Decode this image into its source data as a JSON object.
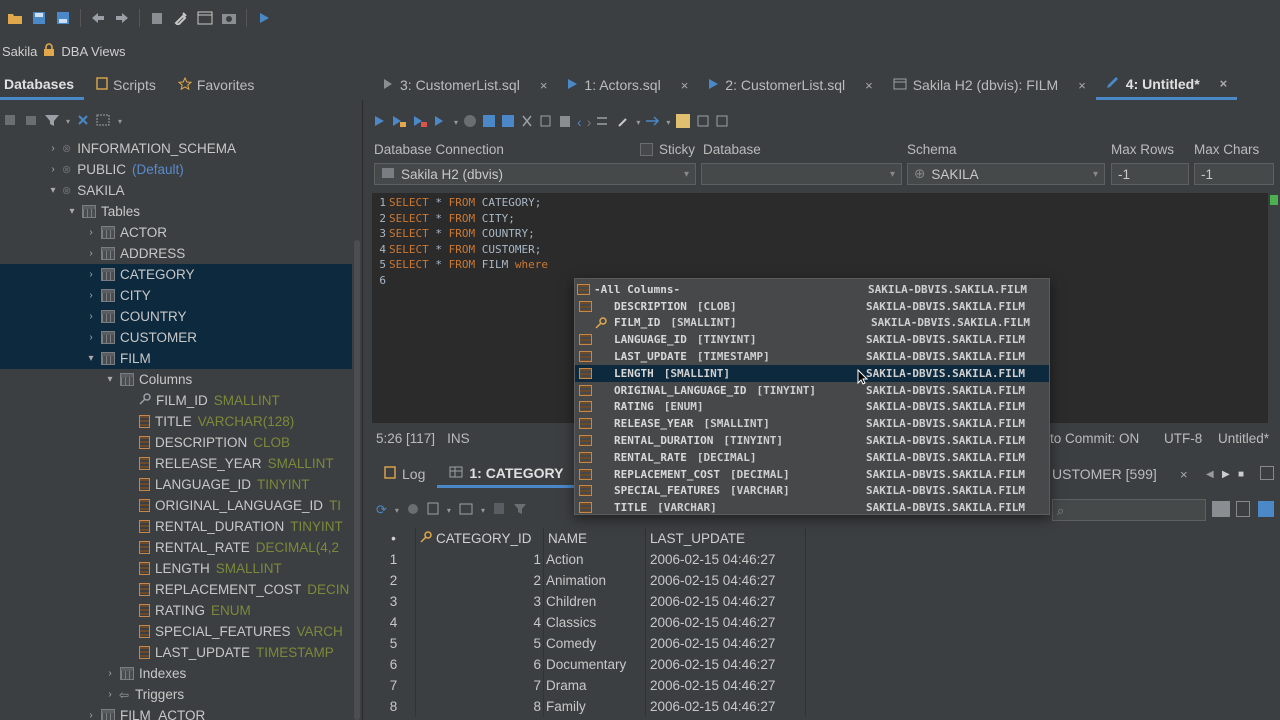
{
  "toolbar": {
    "icons": [
      "open-folder-icon",
      "save-icon",
      "save-all-icon",
      "back-icon",
      "forward-icon",
      "clipboard-icon",
      "tools-icon",
      "window-icon",
      "settings-icon",
      "run-icon"
    ]
  },
  "context": {
    "connection": "Sakila",
    "view": "DBA Views"
  },
  "left_tabs": [
    {
      "label": "Databases",
      "active": true
    },
    {
      "label": "Scripts",
      "active": false
    },
    {
      "label": "Favorites",
      "active": false
    }
  ],
  "tree": {
    "information_schema": "INFORMATION_SCHEMA",
    "public": "PUBLIC",
    "public_tag": "(Default)",
    "sakila": "SAKILA",
    "tables": "Tables",
    "table_items": [
      "ACTOR",
      "ADDRESS",
      "CATEGORY",
      "CITY",
      "COUNTRY",
      "CUSTOMER",
      "FILM"
    ],
    "columns": "Columns",
    "column_items": [
      {
        "name": "FILM_ID",
        "type": "SMALLINT"
      },
      {
        "name": "TITLE",
        "type": "VARCHAR(128)"
      },
      {
        "name": "DESCRIPTION",
        "type": "CLOB"
      },
      {
        "name": "RELEASE_YEAR",
        "type": "SMALLINT"
      },
      {
        "name": "LANGUAGE_ID",
        "type": "TINYINT"
      },
      {
        "name": "ORIGINAL_LANGUAGE_ID",
        "type": "TI"
      },
      {
        "name": "RENTAL_DURATION",
        "type": "TINYINT"
      },
      {
        "name": "RENTAL_RATE",
        "type": "DECIMAL(4,2"
      },
      {
        "name": "LENGTH",
        "type": "SMALLINT"
      },
      {
        "name": "REPLACEMENT_COST",
        "type": "DECIN"
      },
      {
        "name": "RATING",
        "type": "ENUM"
      },
      {
        "name": "SPECIAL_FEATURES",
        "type": "VARCH"
      },
      {
        "name": "LAST_UPDATE",
        "type": "TIMESTAMP"
      }
    ],
    "indexes": "Indexes",
    "triggers": "Triggers",
    "film_actor": "FILM_ACTOR"
  },
  "editor_tabs": [
    {
      "label": "3: CustomerList.sql",
      "active": false
    },
    {
      "label": "1: Actors.sql",
      "active": false
    },
    {
      "label": "2: CustomerList.sql",
      "active": false
    },
    {
      "label": "Sakila H2 (dbvis): FILM",
      "active": false
    },
    {
      "label": "4: Untitled*",
      "active": true
    }
  ],
  "close_glyph": "×",
  "connection_row": {
    "db_connection_label": "Database Connection",
    "sticky_label": "Sticky",
    "database_label": "Database",
    "schema_label": "Schema",
    "max_rows_label": "Max Rows",
    "max_chars_label": "Max Chars",
    "db_connection_value": "Sakila H2 (dbvis)",
    "database_value": "",
    "schema_value": "SAKILA",
    "max_rows_value": "-1",
    "max_chars_value": "-1"
  },
  "code": [
    {
      "n": "1",
      "kw1": "SELECT",
      "star": " * ",
      "kw2": "FROM",
      "rest": " CATEGORY;",
      "kw3": ""
    },
    {
      "n": "2",
      "kw1": "SELECT",
      "star": " * ",
      "kw2": "FROM",
      "rest": " CITY;",
      "kw3": ""
    },
    {
      "n": "3",
      "kw1": "SELECT",
      "star": " * ",
      "kw2": "FROM",
      "rest": " COUNTRY;",
      "kw3": ""
    },
    {
      "n": "4",
      "kw1": "SELECT",
      "star": " * ",
      "kw2": "FROM",
      "rest": " CUSTOMER;",
      "kw3": ""
    },
    {
      "n": "5",
      "kw1": "SELECT",
      "star": " * ",
      "kw2": "FROM",
      "rest": " FILM ",
      "kw3": "where"
    },
    {
      "n": "6",
      "kw1": "",
      "star": "",
      "kw2": "",
      "rest": "",
      "kw3": ""
    }
  ],
  "editor_status": {
    "position": "5:26 [117]",
    "mode": "INS",
    "autocommit": "to Commit: ON",
    "encoding": "UTF-8",
    "file": "Untitled*"
  },
  "result_tabs": [
    {
      "label": "Log",
      "active": false
    },
    {
      "label": "1: CATEGORY",
      "active": true
    }
  ],
  "result_right_tab": "USTOMER [599]",
  "grid": {
    "headers": [
      "CATEGORY_ID",
      "NAME",
      "LAST_UPDATE"
    ],
    "row_marker": "•",
    "rows": [
      {
        "n": "1",
        "id": "1",
        "name": "Action",
        "ts": "2006-02-15 04:46:27"
      },
      {
        "n": "2",
        "id": "2",
        "name": "Animation",
        "ts": "2006-02-15 04:46:27"
      },
      {
        "n": "3",
        "id": "3",
        "name": "Children",
        "ts": "2006-02-15 04:46:27"
      },
      {
        "n": "4",
        "id": "4",
        "name": "Classics",
        "ts": "2006-02-15 04:46:27"
      },
      {
        "n": "5",
        "id": "5",
        "name": "Comedy",
        "ts": "2006-02-15 04:46:27"
      },
      {
        "n": "6",
        "id": "6",
        "name": "Documentary",
        "ts": "2006-02-15 04:46:27"
      },
      {
        "n": "7",
        "id": "7",
        "name": "Drama",
        "ts": "2006-02-15 04:46:27"
      },
      {
        "n": "8",
        "id": "8",
        "name": "Family",
        "ts": "2006-02-15 04:46:27"
      }
    ]
  },
  "popup": {
    "header": "-All Columns-",
    "source": "SAKILA-DBVIS.SAKILA.FILM",
    "items": [
      {
        "name": "DESCRIPTION",
        "type": "[CLOB]"
      },
      {
        "name": "FILM_ID",
        "type": "[SMALLINT]",
        "key": true
      },
      {
        "name": "LANGUAGE_ID",
        "type": "[TINYINT]"
      },
      {
        "name": "LAST_UPDATE",
        "type": "[TIMESTAMP]"
      },
      {
        "name": "LENGTH",
        "type": "[SMALLINT]",
        "selected": true
      },
      {
        "name": "ORIGINAL_LANGUAGE_ID",
        "type": "[TINYINT]"
      },
      {
        "name": "RATING",
        "type": "[ENUM]"
      },
      {
        "name": "RELEASE_YEAR",
        "type": "[SMALLINT]"
      },
      {
        "name": "RENTAL_DURATION",
        "type": "[TINYINT]"
      },
      {
        "name": "RENTAL_RATE",
        "type": "[DECIMAL]"
      },
      {
        "name": "REPLACEMENT_COST",
        "type": "[DECIMAL]"
      },
      {
        "name": "SPECIAL_FEATURES",
        "type": "[VARCHAR]"
      },
      {
        "name": "TITLE",
        "type": "[VARCHAR]"
      }
    ]
  },
  "colors": {
    "accent": "#4a88c7",
    "selection": "#0d293e",
    "keyword": "#cc7832",
    "datatype": "#7a8a3a"
  }
}
